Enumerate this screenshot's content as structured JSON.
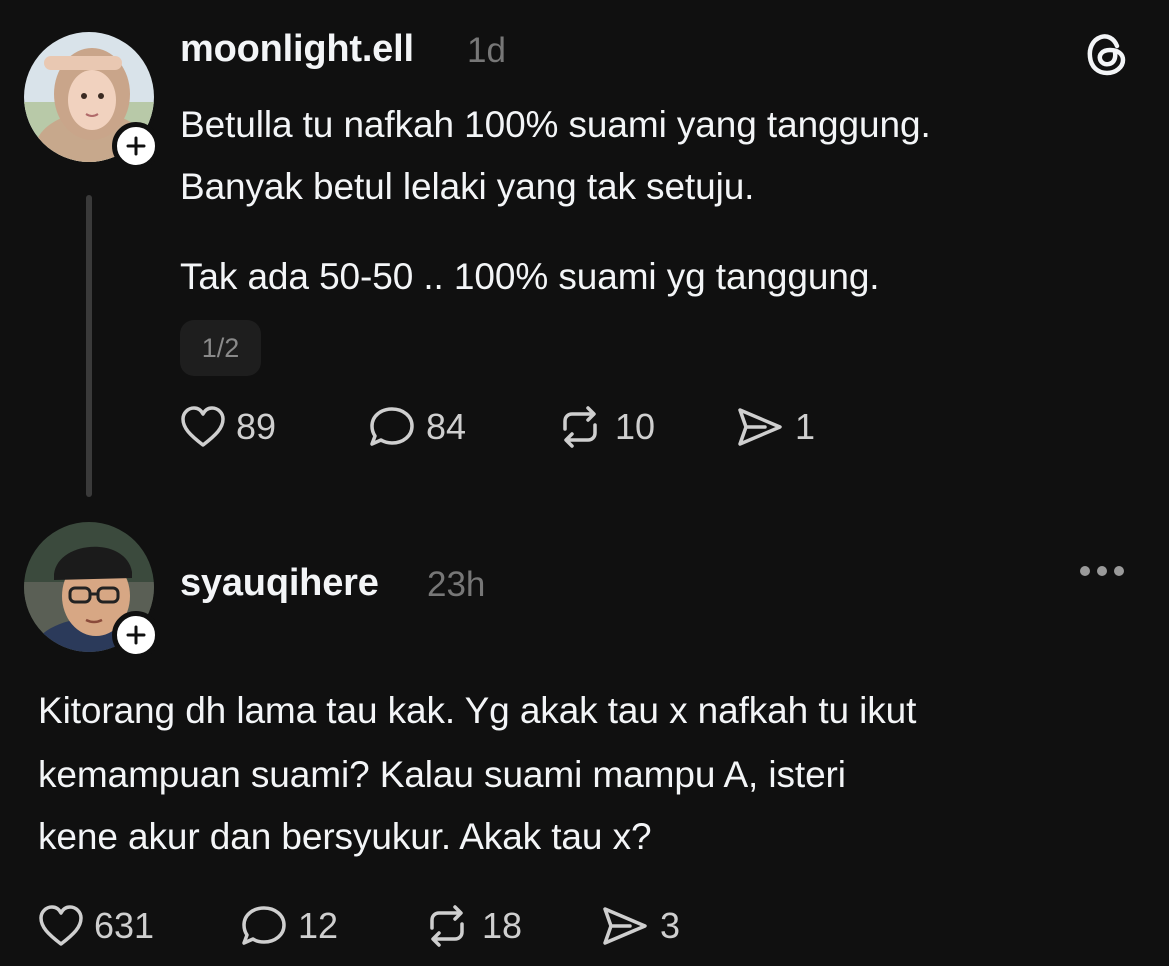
{
  "post1": {
    "username": "moonlight.ell",
    "time": "1d",
    "lines": [
      "Betulla tu nafkah 100% suami yang tanggung.",
      "Banyak betul lelaki yang tak setuju.",
      "Tak ada 50-50 .. 100% suami yg tanggung."
    ],
    "page_indicator": "1/2",
    "likes": "89",
    "comments": "84",
    "reposts": "10",
    "shares": "1"
  },
  "post2": {
    "username": "syauqihere",
    "time": "23h",
    "lines": [
      "Kitorang dh lama tau kak. Yg akak tau x nafkah tu ikut",
      "kemampuan suami? Kalau suami mampu A, isteri",
      "kene akur dan bersyukur. Akak tau x?"
    ],
    "likes": "631",
    "comments": "12",
    "reposts": "18",
    "shares": "3"
  },
  "icons": {
    "brand": "threads-logo-icon",
    "like": "heart-icon",
    "comment": "comment-bubble-icon",
    "repost": "repost-icon",
    "share": "send-icon",
    "more": "more-options-icon",
    "follow": "plus-icon"
  },
  "colors": {
    "background": "#101010",
    "text": "#f3f5f7",
    "muted": "#777777"
  }
}
